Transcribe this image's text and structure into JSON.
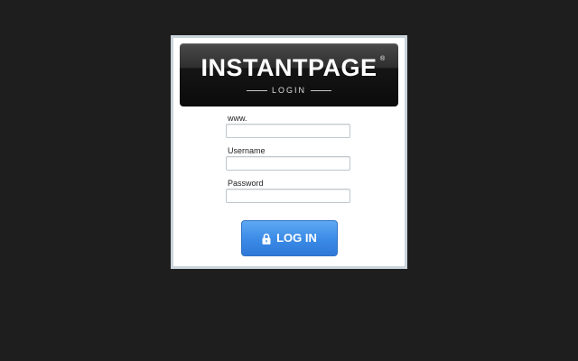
{
  "header": {
    "brand": "INSTANTPAGE",
    "registered_mark": "®",
    "subtitle": "LOGIN"
  },
  "form": {
    "www_label": "www.",
    "username_label": "Username",
    "password_label": "Password",
    "www_value": "",
    "username_value": "",
    "password_value": ""
  },
  "button": {
    "label": "LOG IN",
    "icon": "lock-icon"
  },
  "colors": {
    "background": "#1e1e1e",
    "button_blue": "#3a8ae6"
  }
}
